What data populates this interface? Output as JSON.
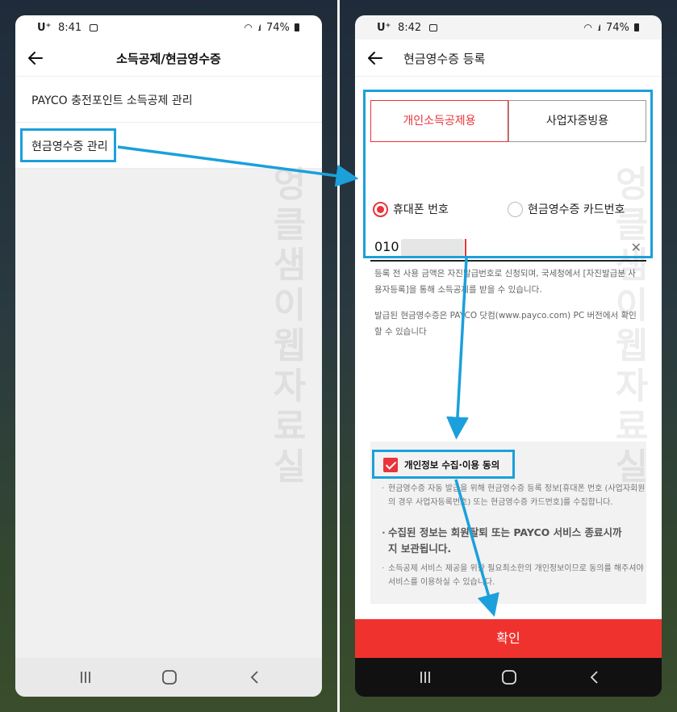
{
  "left_phone": {
    "status": {
      "carrier": "U⁺",
      "time": "8:41",
      "battery": "74%"
    },
    "title": "소득공제/현금영수증",
    "menu": [
      {
        "label": "PAYCO 충전포인트 소득공제 관리"
      },
      {
        "label": "현금영수증 관리"
      }
    ]
  },
  "right_phone": {
    "status": {
      "carrier": "U⁺",
      "time": "8:42",
      "battery": "74%"
    },
    "title": "현금영수증 등록",
    "tabs": [
      {
        "label": "개인소득공제용",
        "active": true
      },
      {
        "label": "사업자증빙용",
        "active": false
      }
    ],
    "radio": [
      {
        "label": "휴대폰 번호",
        "selected": true
      },
      {
        "label": "현금영수증 카드번호",
        "selected": false
      }
    ],
    "phone_input": {
      "value": "010"
    },
    "info": [
      "등록 전 사용 금액은 자진발급번호로 신청되며, 국세청에서 [자진발급분 사용자등록]을 통해 소득공제를 받을 수 있습니다.",
      "발급된 현금영수증은 PAYCO 닷컴(www.payco.com) PC 버전에서 확인할 수 있습니다"
    ],
    "consent": {
      "title": "개인정보 수집·이용 동의",
      "checked": true,
      "p1": "현금영수증 자동 발급을 위해 현금영수증 등록 정보[휴대폰 번호 (사업자회원의 경우 사업자등록번호) 또는 현금영수증 카드번호]를 수집합니다.",
      "strong": "수집된 정보는 회원탈퇴 또는 PAYCO 서비스 종료시까지 보관됩니다.",
      "p3": "소득공제 서비스 제공을 위한 필요최소한의 개인정보이므로 동의를 해주셔야 서비스를 이용하실 수 있습니다."
    },
    "confirm_label": "확인"
  },
  "watermark": "엉클샘이웹자료실",
  "colors": {
    "accent": "#e8343a",
    "annotation": "#1ba0db",
    "confirm": "#f0322f"
  }
}
